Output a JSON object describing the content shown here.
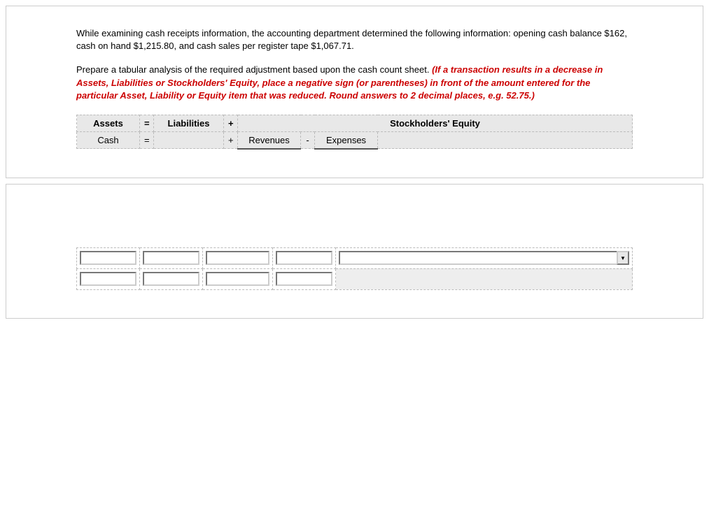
{
  "intro": "While examining cash receipts information, the accounting department determined the following information: opening cash balance $162, cash on hand $1,215.80, and cash sales per register tape $1,067.71.",
  "instructions_plain": "Prepare a tabular analysis of the required adjustment based upon the cash count sheet. ",
  "instructions_red": "(If a transaction results in a decrease in Assets, Liabilities or Stockholders' Equity, place a negative sign (or parentheses) in front of the amount entered for the particular Asset, Liability or Equity item that was reduced. Round answers to 2 decimal places, e.g. 52.75.)",
  "header": {
    "assets": "Assets",
    "eq1": "=",
    "liabilities": "Liabilities",
    "plus1": "+",
    "stockholders": "Stockholders' Equity"
  },
  "subheader": {
    "cash": "Cash",
    "eq2": "=",
    "liab_blank": "",
    "plus2": "+",
    "revenues": "Revenues",
    "minus": "-",
    "expenses": "Expenses",
    "se_blank": ""
  },
  "inputs": {
    "r1c1": "",
    "r1c2": "",
    "r1c3": "",
    "r1c4": "",
    "r1c5": "",
    "r2c1": "",
    "r2c2": "",
    "r2c3": "",
    "r2c4": ""
  }
}
